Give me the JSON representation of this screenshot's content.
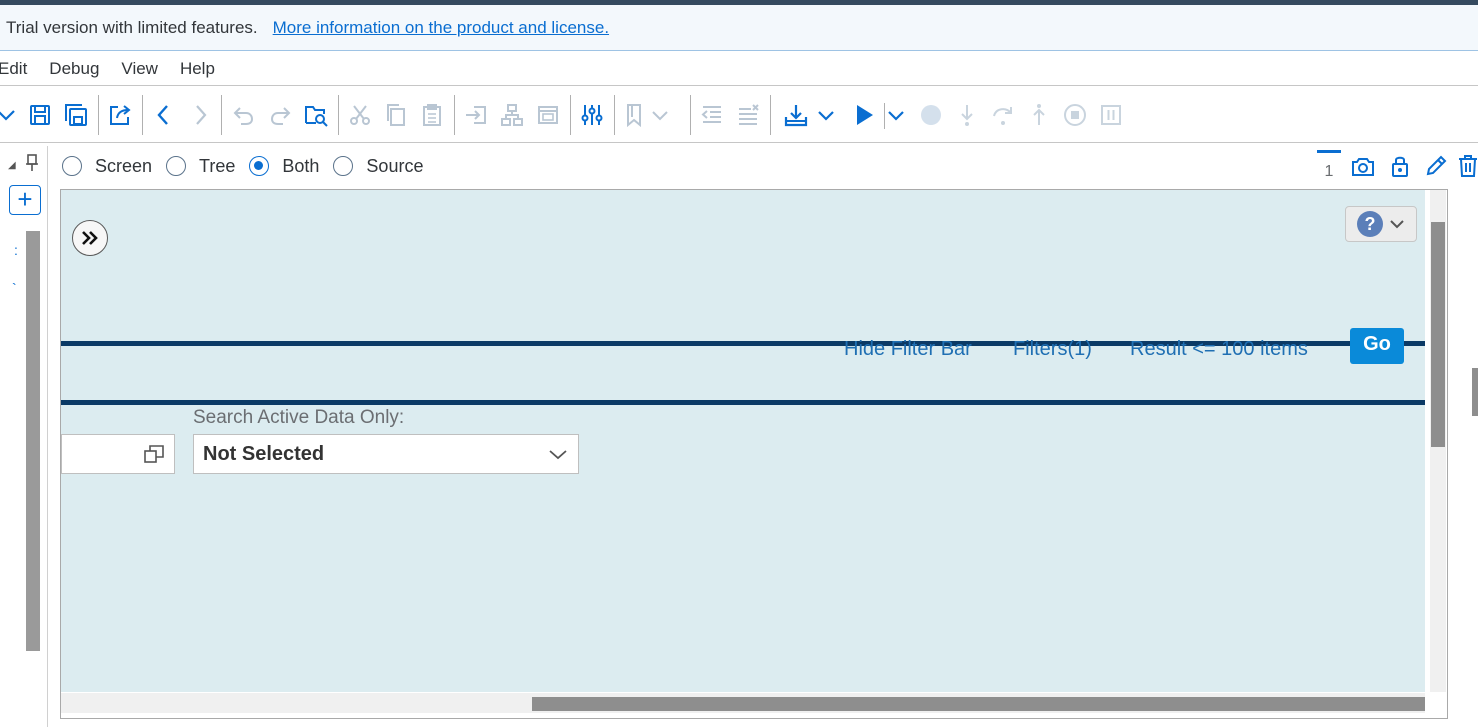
{
  "banner": {
    "message": "Trial version with limited features.",
    "link": "More information on the product and license."
  },
  "menu": [
    "Edit",
    "Debug",
    "View",
    "Help"
  ],
  "view_modes": {
    "options": [
      "Screen",
      "Tree",
      "Both",
      "Source"
    ],
    "selected": "Both"
  },
  "right_tools": {
    "page_number": "1"
  },
  "filter_bar": {
    "hide_filter_bar": "Hide Filter Bar",
    "filters": "Filters(1)",
    "result": "Result <= 100 items",
    "go": "Go"
  },
  "search_active": {
    "label": "Search Active Data Only:",
    "value": "Not Selected"
  },
  "colors": {
    "accent": "#0a6ed1",
    "canvas_bg": "#dcecf0",
    "bar": "#0b3a66",
    "go_button": "#0a8ad9"
  }
}
